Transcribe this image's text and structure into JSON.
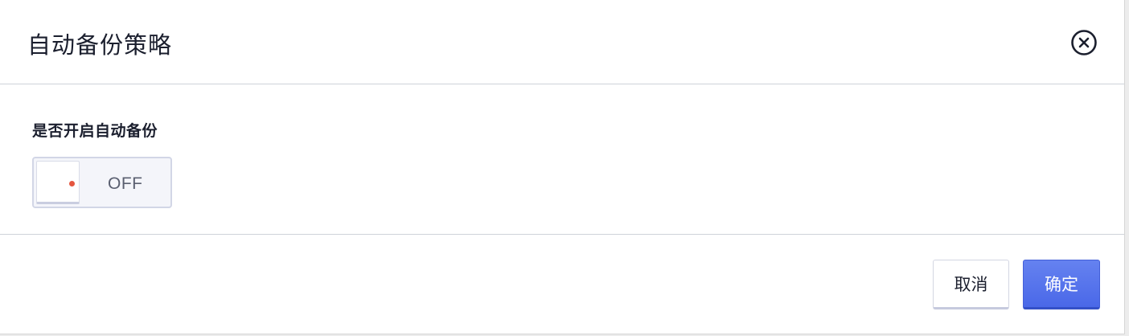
{
  "dialog": {
    "title": "自动备份策略",
    "close_icon": "close-circle-icon"
  },
  "form": {
    "auto_backup_label": "是否开启自动备份",
    "switch": {
      "state_text": "OFF",
      "enabled": false,
      "status_dot_color": "#e5563f"
    }
  },
  "footer": {
    "cancel_label": "取消",
    "confirm_label": "确定"
  },
  "colors": {
    "primary": "#4a68e8",
    "border": "#cfd3d9",
    "text": "#1b1f2e"
  }
}
